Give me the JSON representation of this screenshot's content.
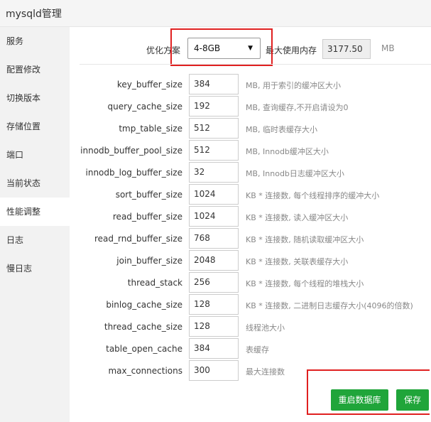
{
  "window": {
    "title": "mysqld管理"
  },
  "sidebar": {
    "items": [
      {
        "label": "服务"
      },
      {
        "label": "配置修改"
      },
      {
        "label": "切换版本"
      },
      {
        "label": "存储位置"
      },
      {
        "label": "端口"
      },
      {
        "label": "当前状态"
      },
      {
        "label": "性能调整"
      },
      {
        "label": "日志"
      },
      {
        "label": "慢日志"
      }
    ],
    "active_index": 6
  },
  "scheme": {
    "label": "优化方案",
    "selected": "4-8GB",
    "max_mem_label": "最大使用内存",
    "max_mem_value": "3177.50",
    "max_mem_unit": "MB"
  },
  "params": [
    {
      "name": "key_buffer_size",
      "value": "384",
      "desc": "MB, 用于索引的缓冲区大小"
    },
    {
      "name": "query_cache_size",
      "value": "192",
      "desc": "MB, 查询缓存,不开启请设为0"
    },
    {
      "name": "tmp_table_size",
      "value": "512",
      "desc": "MB, 临时表缓存大小"
    },
    {
      "name": "innodb_buffer_pool_size",
      "value": "512",
      "desc": "MB, Innodb缓冲区大小"
    },
    {
      "name": "innodb_log_buffer_size",
      "value": "32",
      "desc": "MB, Innodb日志缓冲区大小"
    },
    {
      "name": "sort_buffer_size",
      "value": "1024",
      "desc": "KB * 连接数, 每个线程排序的缓冲大小"
    },
    {
      "name": "read_buffer_size",
      "value": "1024",
      "desc": "KB * 连接数, 读入缓冲区大小"
    },
    {
      "name": "read_rnd_buffer_size",
      "value": "768",
      "desc": "KB * 连接数, 随机读取缓冲区大小"
    },
    {
      "name": "join_buffer_size",
      "value": "2048",
      "desc": "KB * 连接数, 关联表缓存大小"
    },
    {
      "name": "thread_stack",
      "value": "256",
      "desc": "KB * 连接数, 每个线程的堆栈大小"
    },
    {
      "name": "binlog_cache_size",
      "value": "128",
      "desc": "KB * 连接数, 二进制日志缓存大小(4096的倍数)"
    },
    {
      "name": "thread_cache_size",
      "value": "128",
      "desc": "线程池大小"
    },
    {
      "name": "table_open_cache",
      "value": "384",
      "desc": "表缓存"
    },
    {
      "name": "max_connections",
      "value": "300",
      "desc": "最大连接数"
    }
  ],
  "buttons": {
    "restart": "重启数据库",
    "save": "保存"
  },
  "colors": {
    "accent_green": "#20a53a",
    "highlight_red": "#e02020"
  }
}
